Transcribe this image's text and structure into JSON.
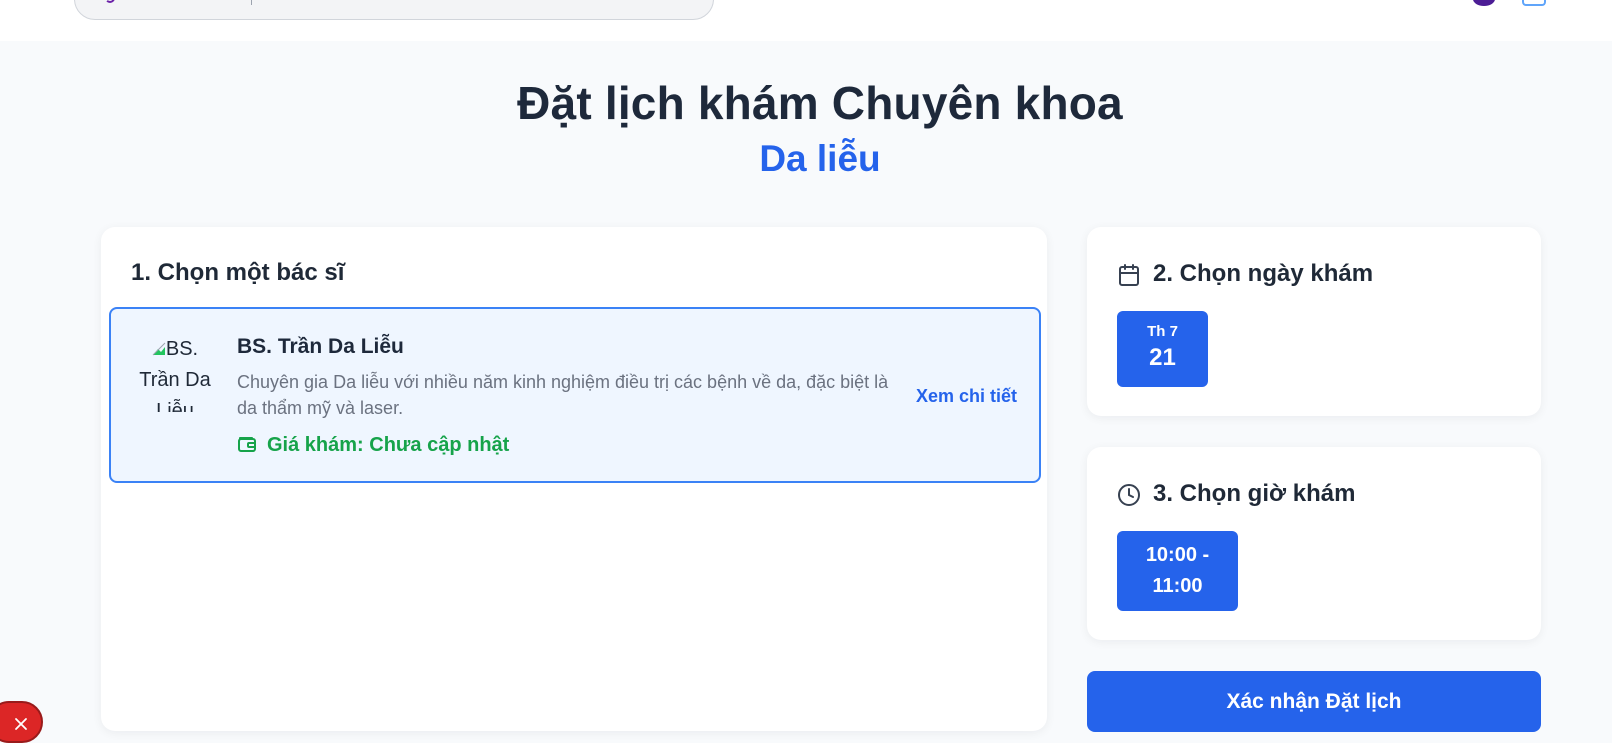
{
  "header": {
    "search_placeholder": "",
    "nav_text": ""
  },
  "page": {
    "title": "Đặt lịch khám Chuyên khoa",
    "subtitle": "Da liễu"
  },
  "doctors_section": {
    "title": "1. Chọn một bác sĩ",
    "doctors": [
      {
        "avatar_alt": "BS. Trần Da Liễu",
        "name": "BS. Trần Da Liễu",
        "description": "Chuyên gia Da liễu với nhiều năm kinh nghiệm điều trị các bệnh về da, đặc biệt là da thẩm mỹ và laser.",
        "price": "Giá khám: Chưa cập nhật",
        "detail_link": "Xem chi tiết",
        "selected": true
      }
    ]
  },
  "date_section": {
    "title": "2. Chọn ngày khám",
    "icon": "calendar-icon",
    "dates": [
      {
        "day_of_week": "Th 7",
        "day": "21",
        "selected": true
      }
    ]
  },
  "time_section": {
    "title": "3. Chọn giờ khám",
    "icon": "clock-icon",
    "slots": [
      {
        "label": "10:00 - 11:00",
        "selected": true
      }
    ]
  },
  "confirm_button": "Xác nhận Đặt lịch",
  "colors": {
    "primary": "#2563eb",
    "price_green": "#16a34a",
    "selected_bg": "#eff6ff",
    "chat_red": "#dc2626"
  }
}
